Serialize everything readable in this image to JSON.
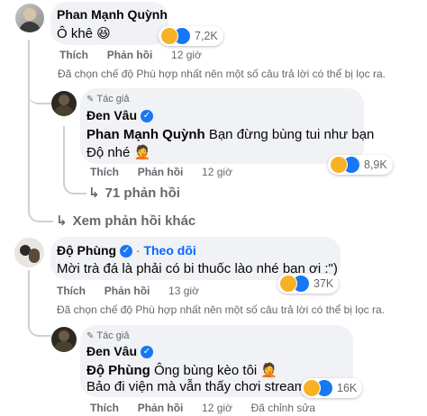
{
  "comment1": {
    "author": "Phan Mạnh Quỳnh",
    "text": "Ô khê 😆",
    "reaction_count": "7,2K",
    "actions": {
      "like": "Thích",
      "reply": "Phản hồi",
      "time": "12 giờ"
    },
    "filter_notice": "Đã chọn chế độ Phù hợp nhất nên một số câu trả lời có thể bị lọc ra."
  },
  "reply1": {
    "author_tag": "Tác giả",
    "author": "Đen Vâu",
    "mention": "Phan Mạnh Quỳnh",
    "text_line1": " Bạn đừng bùng tui như bạn",
    "text_line2": "Độ nhé 🤦",
    "reaction_count": "8,9K",
    "actions": {
      "like": "Thích",
      "reply": "Phản hồi",
      "time": "12 giờ"
    },
    "replies_link": "71 phản hồi"
  },
  "more_replies_link": "Xem phản hồi khác",
  "comment2": {
    "author": "Độ Phùng",
    "separator": "·",
    "follow_label": "Theo dõi",
    "text": "Mời trà đá là phải có bi thuốc lào nhé bạn ơi :\")",
    "reaction_count": "37K",
    "actions": {
      "like": "Thích",
      "reply": "Phản hồi",
      "time": "13 giờ"
    },
    "filter_notice": "Đã chọn chế độ Phù hợp nhất nên một số câu trả lời có thể bị lọc ra."
  },
  "reply2": {
    "author_tag": "Tác giả",
    "author": "Đen Vâu",
    "mention": "Độ Phùng",
    "text_line1": " Ông bùng kèo tôi 🤦",
    "text_line2": "Bảo đi viện mà vẫn thấy chơi stream",
    "reaction_count": "16K",
    "actions": {
      "like": "Thích",
      "reply": "Phản hồi",
      "time": "12 giờ",
      "edited": "Đã chỉnh sửa"
    }
  },
  "colors": {
    "bubble": "#f0f2f5",
    "meta": "#65676b",
    "link": "#0866ff",
    "verified": "#1877f2"
  }
}
